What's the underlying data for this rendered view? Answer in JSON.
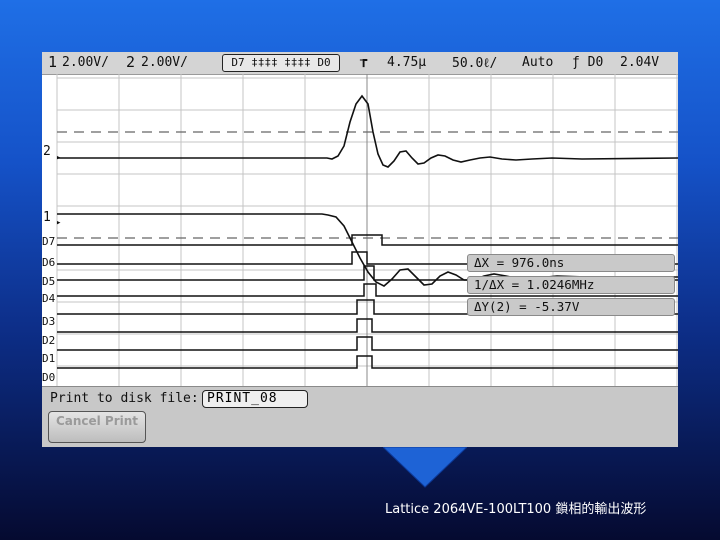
{
  "status_bar": {
    "ch1_label": "1",
    "ch1_scale": "2.00V/",
    "ch2_label": "2",
    "ch2_scale": "2.00V/",
    "digital_channels": "D7 ‡‡‡‡ ‡‡‡‡ D0",
    "trigger_delay": "4.75µ",
    "timebase": "50.0ℓ/",
    "trigger_mode": "Auto",
    "trigger_source": "ƒ D0",
    "trigger_level": "2.04V"
  },
  "channel_markers": {
    "ch2": "2",
    "ch1": "1",
    "d7": "D7",
    "d6": "D6",
    "d5": "D5",
    "d4": "D4",
    "d3": "D3",
    "d2": "D2",
    "d1": "D1",
    "d0": "D0"
  },
  "measurements": {
    "delta_x": "ΔX = 976.0ns",
    "inv_delta_x": "1/ΔX = 1.0246MHz",
    "delta_y": "ΔY(2) = -5.37V"
  },
  "softkeys": {
    "print_label": "Print to disk file:",
    "filename": "PRINT_08",
    "cancel_print": "Cancel Print"
  },
  "caption": "Lattice 2064VE-100LT100 鎖相的輸出波形",
  "colors": {
    "background_top": "#1f6fe6",
    "background_bottom": "#050a30",
    "screen": "#ffffff",
    "panel": "#d4d4d4"
  }
}
